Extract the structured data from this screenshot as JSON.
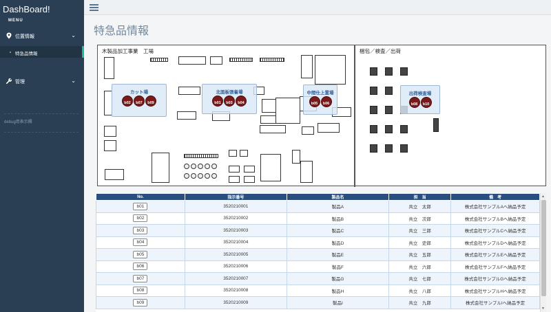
{
  "app": {
    "brand": "DashBoard!",
    "menu_label": "MENU"
  },
  "sidebar": {
    "groups": [
      {
        "label": "位置情報",
        "icon": "map-marker-icon"
      },
      {
        "label": "管理",
        "icon": "wrench-icon"
      }
    ],
    "sub_item": "特急品情報",
    "debug": "debug用表示欄"
  },
  "page": {
    "title": "特急品情報"
  },
  "map": {
    "area_left": "木製品加工事業　工場",
    "area_right": "梱包／検査／出荷",
    "zones": [
      {
        "name": "カット場",
        "disks": [
          "b02",
          "b07",
          "b09"
        ]
      },
      {
        "name": "北面板張着場",
        "disks": [
          "b01",
          "b03",
          "b04"
        ]
      },
      {
        "name": "中間仕上置場",
        "disks": [
          "b05",
          "b06"
        ]
      },
      {
        "name": "出荷検査場",
        "disks": [
          "b08",
          "b10"
        ]
      }
    ]
  },
  "table": {
    "headers": [
      "No.",
      "指示番号",
      "製品名",
      "担　当",
      "備　考"
    ],
    "rows": [
      [
        "b01",
        "3520210001",
        "製品A",
        "共立　太郎",
        "株式会社サンプルAへ納品予定"
      ],
      [
        "b02",
        "3520210002",
        "製品B",
        "共立　次郎",
        "株式会社サンプルBへ納品予定"
      ],
      [
        "b03",
        "3520210003",
        "製品C",
        "共立　三郎",
        "株式会社サンプルCへ納品予定"
      ],
      [
        "b04",
        "3520210004",
        "製品D",
        "共立　史郎",
        "株式会社サンプルDへ納品予定"
      ],
      [
        "b05",
        "3520210005",
        "製品E",
        "共立　五郎",
        "株式会社サンプルEへ納品予定"
      ],
      [
        "b06",
        "3520210006",
        "製品F",
        "共立　六郎",
        "株式会社サンプルFへ納品予定"
      ],
      [
        "b07",
        "3520210007",
        "製品G",
        "共立　七郎",
        "株式会社サンプルGへ納品予定"
      ],
      [
        "b08",
        "3520210008",
        "製品H",
        "共立　八郎",
        "株式会社サンプルHへ納品予定"
      ],
      [
        "b09",
        "3520210009",
        "製品I",
        "共立　九郎",
        "株式会社サンプルIへ納品予定"
      ]
    ]
  },
  "colors": {
    "sidebar": "#2a3f54",
    "accent": "#1abb9c",
    "table_header": "#2a4e7e",
    "disk": "#7a1a1a"
  }
}
